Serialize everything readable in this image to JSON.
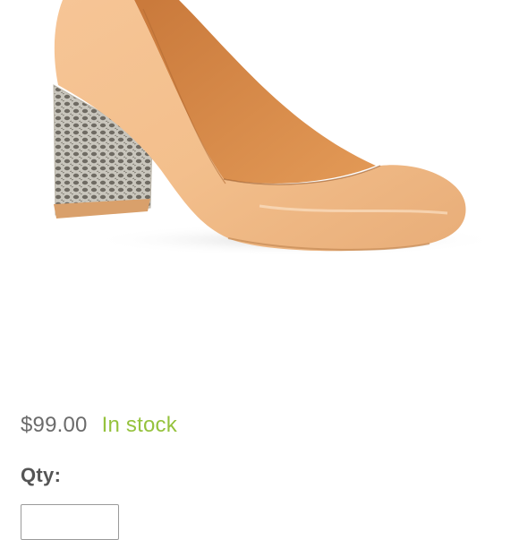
{
  "product": {
    "image_icon": "shoe-image",
    "price": "$99.00",
    "stock_status": "In stock",
    "stock_color": "#95c23d",
    "price_color": "#6b6b6b"
  },
  "quantity": {
    "label": "Qty:",
    "value": ""
  }
}
